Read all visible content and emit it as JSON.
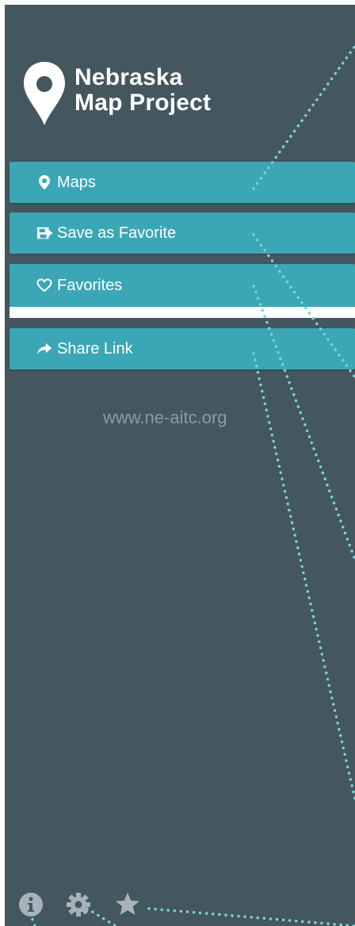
{
  "app": {
    "title_line1": "Nebraska",
    "title_line2": "Map Project",
    "website": "www.ne-aitc.org"
  },
  "menu": {
    "items": [
      {
        "label": "Maps",
        "icon": "map-marker-icon"
      },
      {
        "label": "Save as Favorite",
        "icon": "floppy-save-icon"
      },
      {
        "label": "Favorites",
        "icon": "heart-icon"
      },
      {
        "label": "Share Link",
        "icon": "share-arrow-icon"
      }
    ]
  },
  "footer": {
    "icons": [
      "info-icon",
      "gear-icon",
      "star-icon"
    ]
  },
  "colors": {
    "panel_bg": "#44575f",
    "button_bg": "#3aa6b6",
    "dotted_line": "#7fd1d8",
    "icon_gray": "#a7b3b8"
  }
}
